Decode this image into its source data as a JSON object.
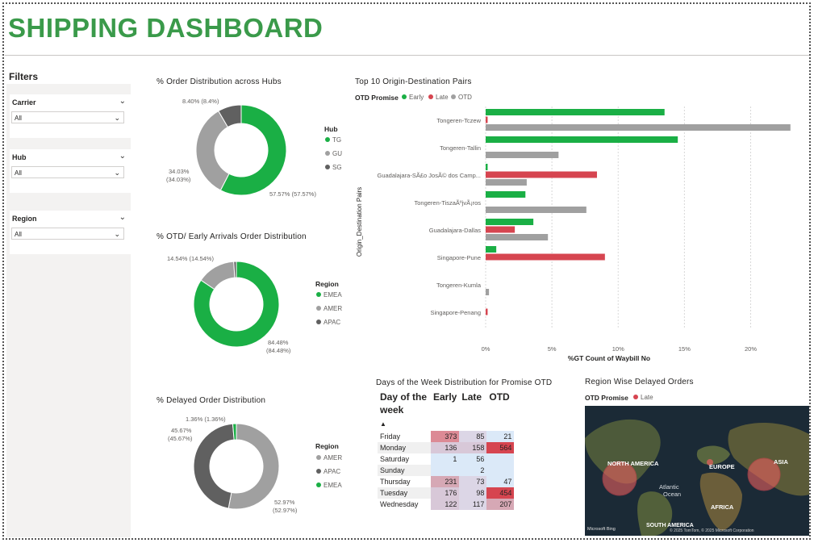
{
  "header": {
    "title": "SHIPPING DASHBOARD"
  },
  "filters": {
    "title": "Filters",
    "carrier": {
      "label": "Carrier",
      "value": "All"
    },
    "hub": {
      "label": "Hub",
      "value": "All"
    },
    "region": {
      "label": "Region",
      "value": "All"
    }
  },
  "colors": {
    "green": "#1aaf45",
    "lightgray": "#a0a0a0",
    "darkgray": "#606060",
    "red": "#d64550"
  },
  "hubs_donut": {
    "title": "% Order Distribution across Hubs",
    "legend_title": "Hub",
    "legend": [
      "TG",
      "GU",
      "SG"
    ],
    "labels": {
      "tg": "57.57% (57.57%)",
      "gu_a": "34.03%",
      "gu_b": "(34.03%)",
      "sg": "8.40% (8.4%)"
    }
  },
  "otd_donut": {
    "title": "% OTD/ Early Arrivals Order Distribution",
    "legend_title": "Region",
    "legend": [
      "EMEA",
      "AMER",
      "APAC"
    ],
    "labels": {
      "emea_a": "84.48%",
      "emea_b": "(84.48%)",
      "amer": "14.54% (14.54%)"
    }
  },
  "delayed_donut": {
    "title": "% Delayed Order Distribution",
    "legend_title": "Region",
    "legend": [
      "AMER",
      "APAC",
      "EMEA"
    ],
    "labels": {
      "amer_a": "52.97%",
      "amer_b": "(52.97%)",
      "apac_a": "45.67%",
      "apac_b": "(45.67%)",
      "emea": "1.36% (1.36%)"
    }
  },
  "chart_data": [
    {
      "type": "pie",
      "title": "% Order Distribution across Hubs",
      "categories": [
        "TG",
        "GU",
        "SG"
      ],
      "values": [
        57.57,
        34.03,
        8.4
      ]
    },
    {
      "type": "pie",
      "title": "% OTD/ Early Arrivals Order Distribution",
      "categories": [
        "EMEA",
        "AMER",
        "APAC"
      ],
      "values": [
        84.48,
        14.54,
        0.98
      ]
    },
    {
      "type": "pie",
      "title": "% Delayed Order Distribution",
      "categories": [
        "AMER",
        "APAC",
        "EMEA"
      ],
      "values": [
        52.97,
        45.67,
        1.36
      ]
    },
    {
      "type": "bar",
      "title": "Top 10 Origin-Destination Pairs",
      "legend_title": "OTD Promise",
      "xlabel": "%GT Count of Waybill No",
      "ylabel": "Origin_Destination Pairs",
      "xlim": [
        0,
        23.5
      ],
      "xticks": [
        "0%",
        "5%",
        "10%",
        "15%",
        "20%"
      ],
      "categories": [
        "Tongeren-Tczew",
        "Tongeren-Tallin",
        "Guadalajara-SÃ£o JosÃ© dos Camp...",
        "Tongeren-TiszaÃºjvÃ¡ros",
        "Guadalajara-Dallas",
        "Singapore-Pune",
        "Tongeren-Kumla",
        "Singapore-Penang"
      ],
      "series": [
        {
          "name": "Early",
          "values": [
            13.5,
            14.5,
            0.15,
            3.0,
            3.6,
            0.8,
            0,
            0
          ]
        },
        {
          "name": "Late",
          "values": [
            0.15,
            0,
            8.4,
            0,
            2.2,
            9.0,
            0,
            0.15
          ]
        },
        {
          "name": "OTD",
          "values": [
            23.0,
            5.5,
            3.1,
            7.6,
            4.7,
            0,
            0.25,
            0
          ]
        }
      ]
    },
    {
      "type": "table",
      "title": "Days of the Week Distribution for Promise OTD",
      "columns": [
        "Day of the week",
        "Early",
        "Late",
        "OTD"
      ],
      "rows": [
        [
          "Friday",
          "373",
          "85",
          "21"
        ],
        [
          "Monday",
          "136",
          "158",
          "564"
        ],
        [
          "Saturday",
          "1",
          "56",
          ""
        ],
        [
          "Sunday",
          "",
          "2",
          ""
        ],
        [
          "Thursday",
          "231",
          "73",
          "47"
        ],
        [
          "Tuesday",
          "176",
          "98",
          "454"
        ],
        [
          "Wednesday",
          "122",
          "117",
          "207"
        ]
      ]
    }
  ],
  "bar_chart": {
    "title": "Top 10 Origin-Destination Pairs",
    "legend_title": "OTD Promise",
    "legend": [
      "Early",
      "Late",
      "OTD"
    ]
  },
  "matrix": {
    "title": "Days of the Week Distribution for Promise OTD",
    "col_day_a": "Day of the",
    "col_day_b": "week",
    "col_early": "Early",
    "col_late": "Late",
    "col_otd": "OTD"
  },
  "map": {
    "title": "Region Wise Delayed Orders",
    "legend_title": "OTD Promise",
    "legend": "Late",
    "labels": {
      "na": "NORTH AMERICA",
      "eu": "EUROPE",
      "asia": "ASIA",
      "atl_a": "Atlantic",
      "atl_b": "Ocean",
      "af": "AFRICA",
      "sa": "SOUTH AMERICA"
    },
    "attribution": "© 2025 TomTom, © 2025 Microsoft Corporation",
    "bing": "Microsoft Bing"
  }
}
